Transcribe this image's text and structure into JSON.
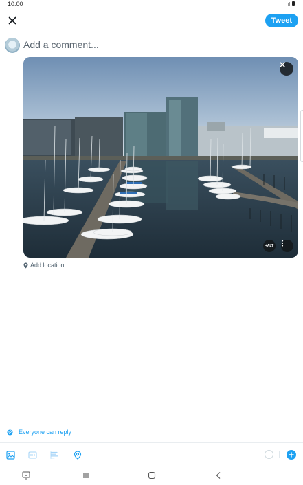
{
  "status_bar": {
    "time": "10:00"
  },
  "header": {
    "tweet_label": "Tweet"
  },
  "composer": {
    "placeholder": "Add a comment..."
  },
  "media": {
    "alt_label": "+ALT"
  },
  "location": {
    "label": "Add location"
  },
  "reply": {
    "label": "Everyone can reply"
  },
  "colors": {
    "accent": "#1da1f2",
    "text_secondary": "#536471",
    "placeholder": "#5b6670"
  },
  "icons": {
    "close": "close-icon",
    "remove_media": "close-icon",
    "more": "more-vertical-icon",
    "location": "location-pin-icon",
    "globe": "globe-icon",
    "toolbar": [
      "image-icon",
      "gif-icon",
      "poll-icon",
      "location-icon"
    ],
    "add_thread": "plus-icon",
    "nav": [
      "recent-apps-icon",
      "home-icon",
      "back-icon",
      "keyboard-icon"
    ]
  }
}
